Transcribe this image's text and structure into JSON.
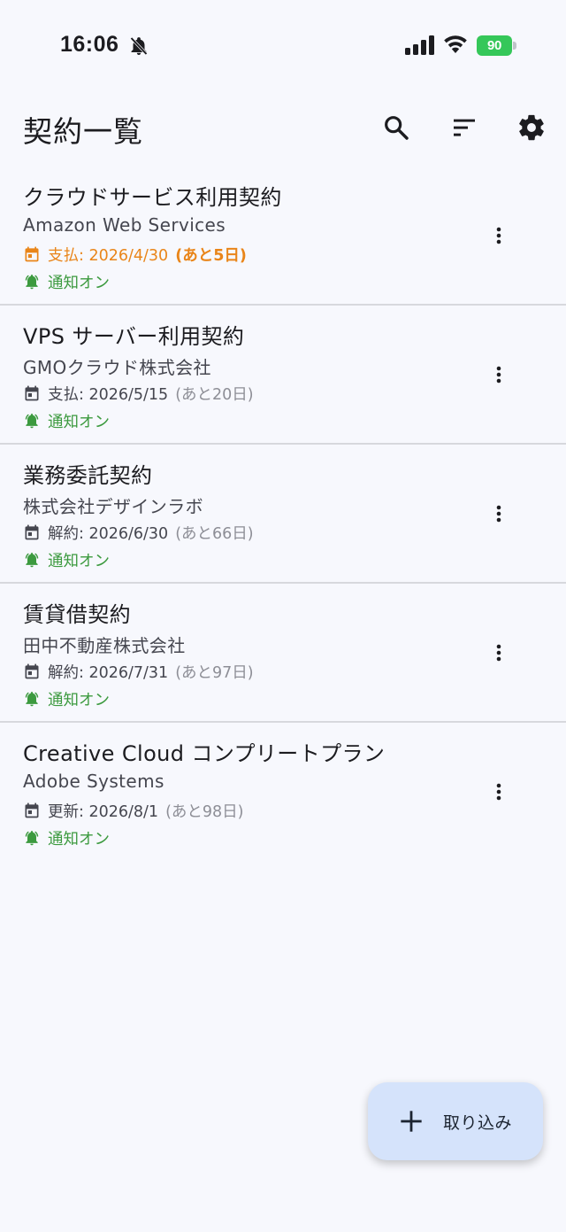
{
  "status_bar": {
    "time": "16:06",
    "battery": "90",
    "icons": [
      "bell-off-icon",
      "signal-icon",
      "wifi-icon",
      "battery-icon"
    ]
  },
  "app_bar": {
    "title": "契約一覧",
    "actions": [
      "search-icon",
      "sort-icon",
      "settings-icon"
    ]
  },
  "contracts": [
    {
      "title": "クラウドサービス利用契約",
      "company": "Amazon Web Services",
      "date_text": "支払: 2026/4/30",
      "remaining": "(あと5日)",
      "urgent": true,
      "notify": "通知オン"
    },
    {
      "title": "VPS サーバー利用契約",
      "company": "GMOクラウド株式会社",
      "date_text": "支払: 2026/5/15",
      "remaining": "(あと20日)",
      "urgent": false,
      "notify": "通知オン"
    },
    {
      "title": "業務委託契約",
      "company": "株式会社デザインラボ",
      "date_text": "解約: 2026/6/30",
      "remaining": "(あと66日)",
      "urgent": false,
      "notify": "通知オン"
    },
    {
      "title": "賃貸借契約",
      "company": "田中不動産株式会社",
      "date_text": "解約: 2026/7/31",
      "remaining": "(あと97日)",
      "urgent": false,
      "notify": "通知オン"
    },
    {
      "title": "Creative Cloud コンプリートプラン",
      "company": "Adobe Systems",
      "date_text": "更新: 2026/8/1",
      "remaining": "(あと98日)",
      "urgent": false,
      "notify": "通知オン"
    }
  ],
  "fab": {
    "label": "取り込み",
    "icon": "plus-icon"
  },
  "colors": {
    "background": "#f7f8fd",
    "urgent": "#e98519",
    "notify": "#3c9a3f",
    "fab": "#d5e3fb",
    "battery": "#35c759"
  }
}
